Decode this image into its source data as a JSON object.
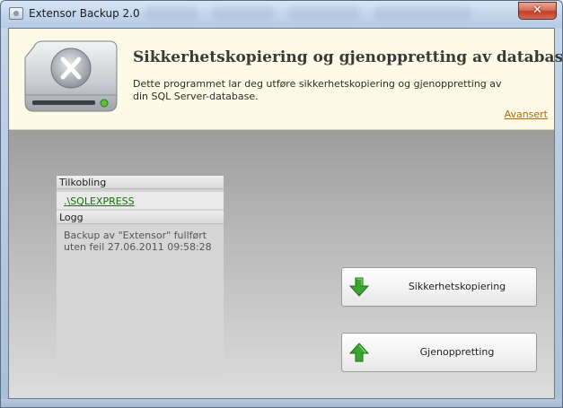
{
  "window": {
    "title": "Extensor Backup 2.0",
    "close_symbol": "✕"
  },
  "header": {
    "title": "Sikkerhetskopiering og gjenoppretting av database",
    "description": "Dette programmet lar deg utføre sikkerhetskopiering og gjenoppretting av din SQL Server-database.",
    "advanced_link": "Avansert"
  },
  "connection": {
    "label": "Tilkobling",
    "server": ".\\SQLEXPRESS"
  },
  "log": {
    "label": "Logg",
    "message": "Backup av \"Extensor\" fullført uten feil 27.06.2011 09:58:28"
  },
  "actions": {
    "backup_label": "Sikkerhetskopiering",
    "restore_label": "Gjenoppretting"
  },
  "colors": {
    "header_bg": "#fdfbe6",
    "link_orange": "#b46a12",
    "link_green": "#1c6b10",
    "arrow_green": "#3aa52e"
  },
  "icons": {
    "app": "app-icon",
    "drive": "drive-icon",
    "down_arrow": "down-arrow-icon",
    "up_arrow": "up-arrow-icon"
  }
}
